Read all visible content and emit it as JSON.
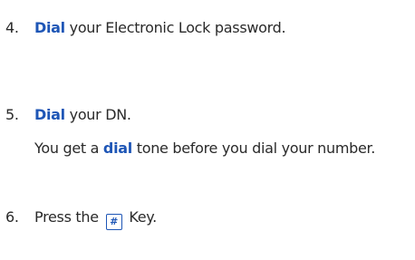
{
  "steps": [
    {
      "number": "4.",
      "keyword": "Dial",
      "text": " your Electronic Lock password."
    },
    {
      "number": "5.",
      "keyword": "Dial",
      "text": " your DN."
    },
    {
      "number": "6.",
      "prefix": "Press the ",
      "key_symbol": "#",
      "suffix": " Key."
    }
  ],
  "note": {
    "prefix": "You get a ",
    "keyword": "dial",
    "suffix": " tone before you dial your number."
  },
  "colors": {
    "accent": "#1e56b6",
    "text": "#2a2a2a"
  },
  "icons": {
    "hash_key": "hash-key-icon"
  }
}
